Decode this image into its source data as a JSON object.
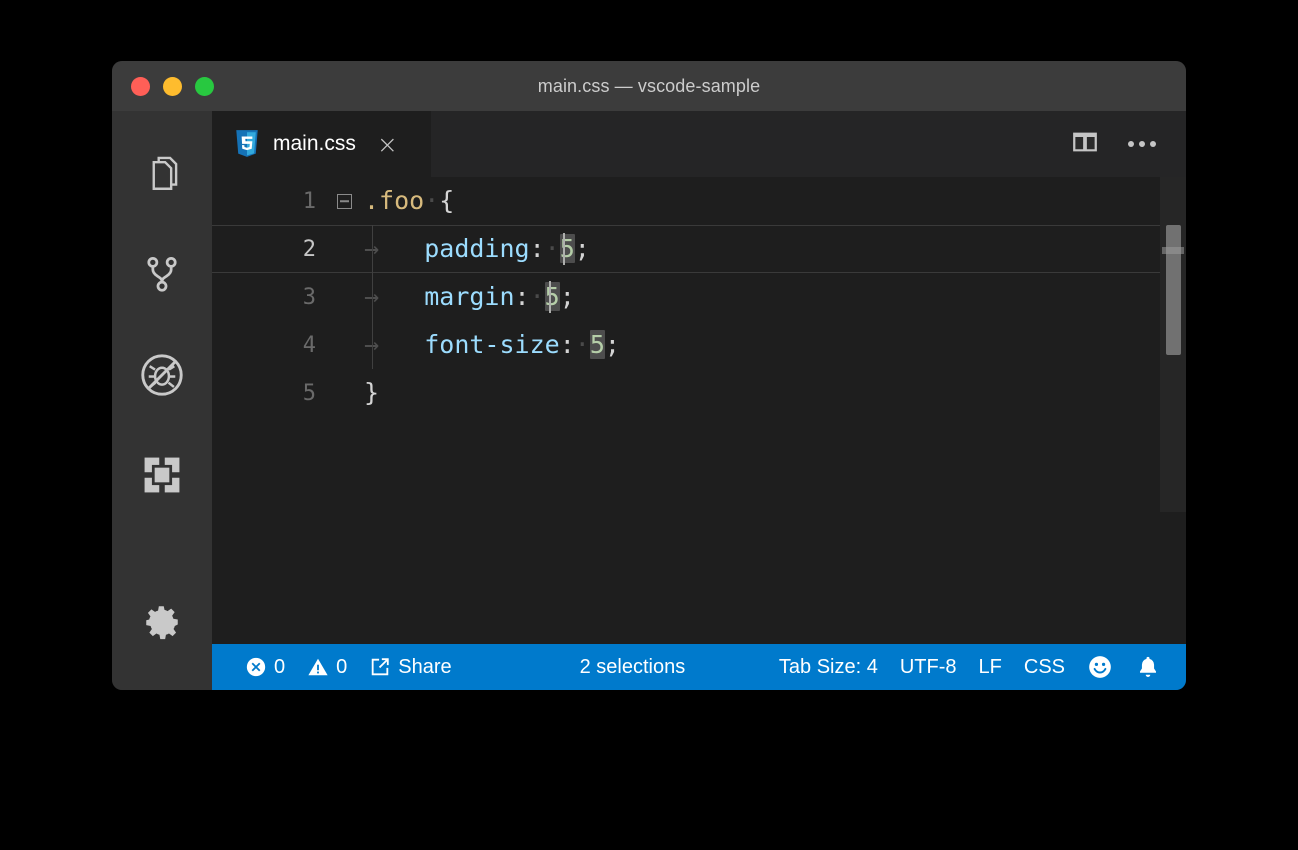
{
  "window": {
    "title": "main.css — vscode-sample",
    "traffic_lights": [
      {
        "name": "close",
        "color": "#ff5f57"
      },
      {
        "name": "minimize",
        "color": "#febc2e"
      },
      {
        "name": "zoom",
        "color": "#28c840"
      }
    ]
  },
  "activity_bar": {
    "items": [
      {
        "icon": "explorer-files-icon",
        "label": "Explorer"
      },
      {
        "icon": "source-control-branch-icon",
        "label": "Source Control"
      },
      {
        "icon": "run-and-debug-disabled-icon",
        "label": "Run and Debug"
      },
      {
        "icon": "extensions-icon",
        "label": "Extensions"
      }
    ],
    "bottom_items": [
      {
        "icon": "gear-icon",
        "label": "Manage"
      }
    ]
  },
  "tab_bar": {
    "tab": {
      "icon": "css-file-icon",
      "label": "main.css",
      "close_glyph": "×"
    },
    "actions": [
      {
        "icon": "split-editor-icon",
        "label": "Split Editor"
      },
      {
        "icon": "more-actions-icon",
        "label": "More Actions..."
      }
    ]
  },
  "editor": {
    "language": "css",
    "lines": [
      {
        "number": "1",
        "folded": false,
        "has_fold_control": true,
        "active": false,
        "text": ".foo {",
        "tokens": [
          {
            "type": "selector",
            "text": ".foo"
          },
          {
            "type": "whitespace-dot",
            "text": "·"
          },
          {
            "type": "punctuation",
            "text": "{"
          }
        ]
      },
      {
        "number": "2",
        "folded": false,
        "has_fold_control": false,
        "active": true,
        "text": "\tpadding: 5;",
        "tokens": [
          {
            "type": "tab-arrow",
            "text": "→"
          },
          {
            "type": "property",
            "text": "padding"
          },
          {
            "type": "punctuation",
            "text": ":"
          },
          {
            "type": "whitespace-dot",
            "text": "·"
          },
          {
            "type": "number",
            "text": "5",
            "selected": true,
            "cursor": "before"
          },
          {
            "type": "punctuation",
            "text": ";"
          }
        ]
      },
      {
        "number": "3",
        "folded": false,
        "has_fold_control": false,
        "active": false,
        "text": "\tmargin: 5;",
        "tokens": [
          {
            "type": "tab-arrow",
            "text": "→"
          },
          {
            "type": "property",
            "text": "margin"
          },
          {
            "type": "punctuation",
            "text": ":"
          },
          {
            "type": "whitespace-dot",
            "text": "·"
          },
          {
            "type": "number",
            "text": "5",
            "selected": true,
            "cursor": "after"
          },
          {
            "type": "punctuation",
            "text": ";"
          }
        ]
      },
      {
        "number": "4",
        "folded": false,
        "has_fold_control": false,
        "active": false,
        "text": "\tfont-size: 5;",
        "tokens": [
          {
            "type": "tab-arrow",
            "text": "→"
          },
          {
            "type": "property",
            "text": "font-size"
          },
          {
            "type": "punctuation",
            "text": ":"
          },
          {
            "type": "whitespace-dot",
            "text": "·"
          },
          {
            "type": "number",
            "text": "5",
            "selected": true
          },
          {
            "type": "punctuation",
            "text": ";"
          }
        ]
      },
      {
        "number": "5",
        "folded": false,
        "has_fold_control": false,
        "active": false,
        "text": "}",
        "tokens": [
          {
            "type": "punctuation",
            "text": "}"
          }
        ]
      }
    ],
    "line_numbers": [
      "1",
      "2",
      "3",
      "4",
      "5"
    ],
    "code_line_1": ".foo",
    "code_line_1_brace": "{",
    "code_line_2_prop": "padding",
    "code_line_2_colon": ":",
    "code_line_2_value": "5",
    "code_line_2_semi": ";",
    "code_line_3_prop": "margin",
    "code_line_3_colon": ":",
    "code_line_3_value": "5",
    "code_line_3_semi": ";",
    "code_line_4_prop": "font-size",
    "code_line_4_colon": ":",
    "code_line_4_value": "5",
    "code_line_4_semi": ";",
    "code_line_5": "}",
    "tab_arrow_glyph": "→",
    "space_dot_glyph": "·"
  },
  "status_bar": {
    "left": [
      {
        "name": "errors",
        "icon": "error-circle-x-icon",
        "value": "0"
      },
      {
        "name": "warnings",
        "icon": "warning-triangle-icon",
        "value": "0"
      },
      {
        "name": "share",
        "icon": "external-link-icon",
        "value": "Share"
      }
    ],
    "center": [
      {
        "name": "selections",
        "value": "2 selections"
      }
    ],
    "right": [
      {
        "name": "tab-size",
        "value": "Tab Size: 4"
      },
      {
        "name": "encoding",
        "value": "UTF-8"
      },
      {
        "name": "eol",
        "value": "LF"
      },
      {
        "name": "language-mode",
        "value": "CSS"
      },
      {
        "name": "feedback",
        "icon": "smiley-icon",
        "value": ""
      },
      {
        "name": "notifications",
        "icon": "bell-icon",
        "value": ""
      }
    ],
    "background_color": "#007acc",
    "foreground_color": "#ffffff"
  },
  "theme": {
    "editor_background": "#1e1e1e",
    "titlebar_background": "#3c3c3c",
    "activitybar_background": "#333333",
    "tabbar_background": "#252526",
    "selector_color": "#d7ba7d",
    "property_color": "#9cdcfe",
    "number_color": "#b5cea8",
    "selection_color": "#4d4d4d",
    "cursor_color": "#aeafad"
  }
}
